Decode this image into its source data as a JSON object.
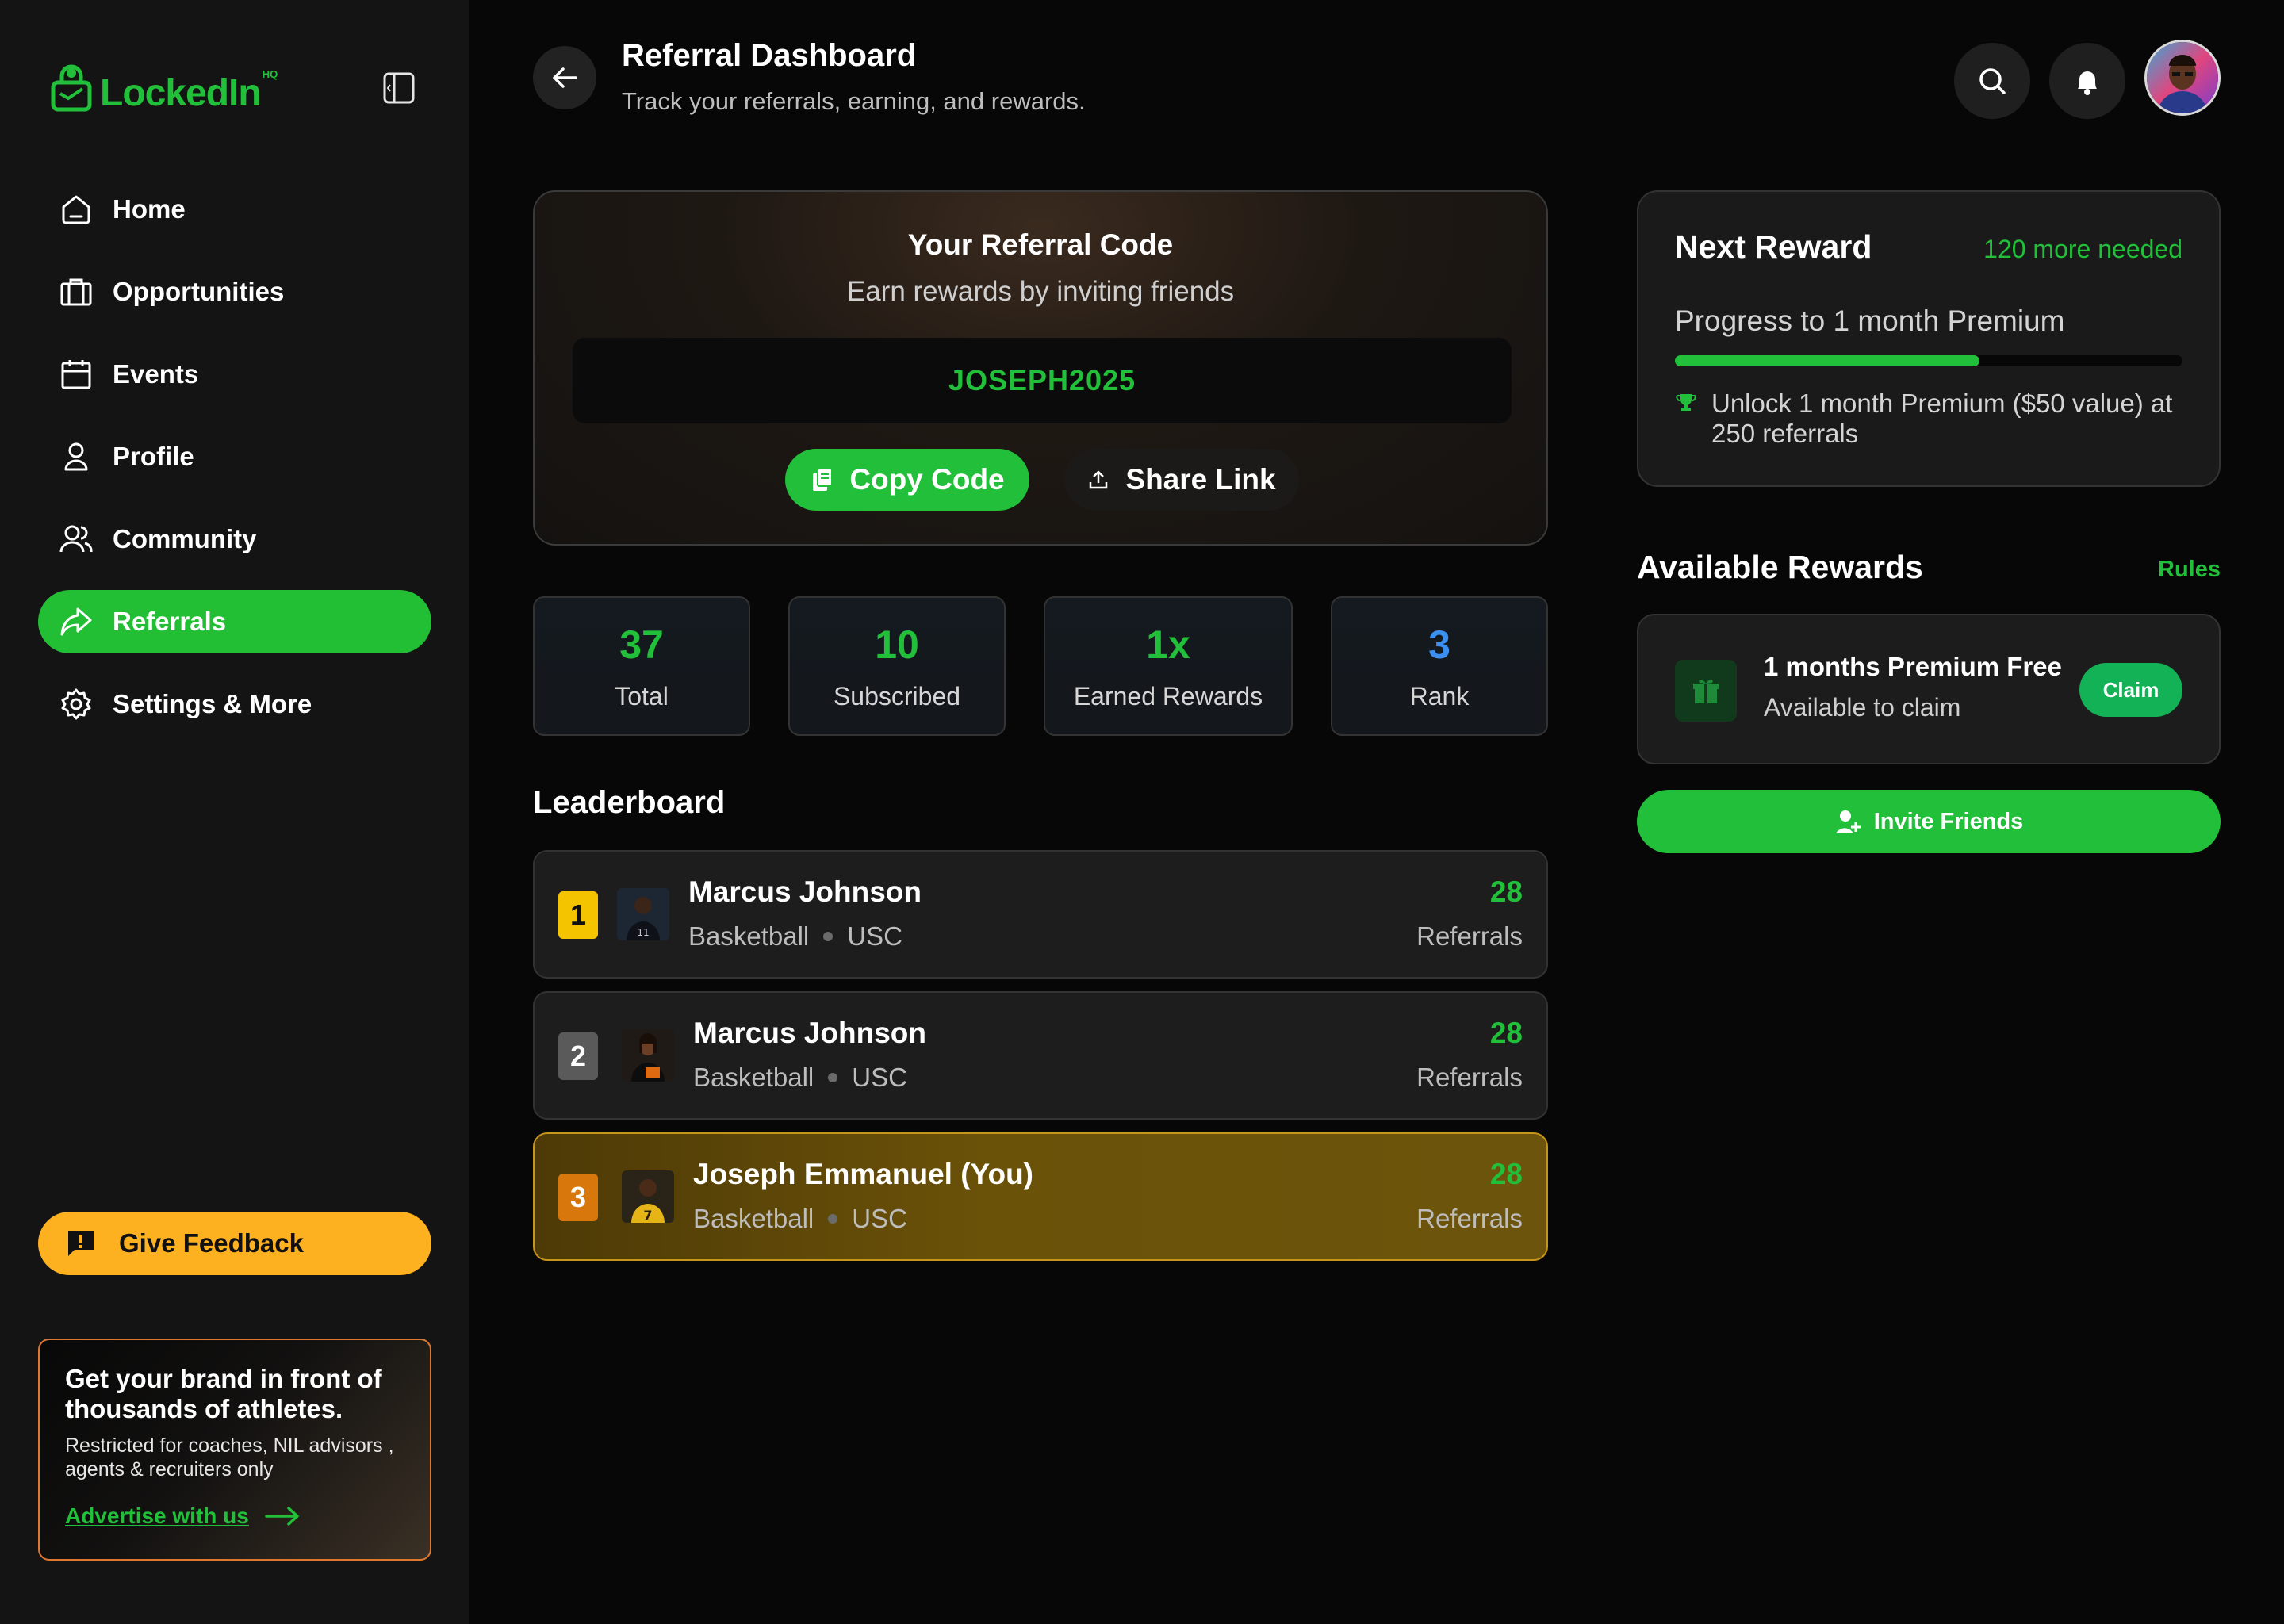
{
  "brand": {
    "name": "LockedIn",
    "suffix": "HQ"
  },
  "sidebar": {
    "items": [
      {
        "label": "Home",
        "icon": "home-icon",
        "active": false
      },
      {
        "label": "Opportunities",
        "icon": "briefcase-icon",
        "active": false
      },
      {
        "label": "Events",
        "icon": "calendar-icon",
        "active": false
      },
      {
        "label": "Profile",
        "icon": "user-icon",
        "active": false
      },
      {
        "label": "Community",
        "icon": "users-icon",
        "active": false
      },
      {
        "label": "Referrals",
        "icon": "share-arrow-icon",
        "active": true
      },
      {
        "label": "Settings & More",
        "icon": "gear-icon",
        "active": false
      }
    ],
    "feedback_label": "Give Feedback",
    "advert": {
      "title": "Get your brand in front of thousands of athletes.",
      "subtitle": "Restricted for coaches, NIL advisors , agents & recruiters only",
      "link": "Advertise with us"
    }
  },
  "header": {
    "title": "Referral Dashboard",
    "subtitle": "Track your referrals, earning, and rewards."
  },
  "referral": {
    "title": "Your Referral Code",
    "subtitle": "Earn rewards by inviting friends",
    "code": "JOSEPH2025",
    "copy_label": "Copy Code",
    "share_label": "Share Link"
  },
  "stats": [
    {
      "value": "37",
      "label": "Total",
      "color": "#22c03a"
    },
    {
      "value": "10",
      "label": "Subscribed",
      "color": "#22c03a"
    },
    {
      "value": "1x",
      "label": "Earned Rewards",
      "color": "#22c03a"
    },
    {
      "value": "3",
      "label": "Rank",
      "color": "#3b8ff0"
    }
  ],
  "leaderboard": {
    "title": "Leaderboard",
    "rows": [
      {
        "rank": "1",
        "name": "Marcus Johnson",
        "sport": "Basketball",
        "school": "USC",
        "count": "28",
        "count_label": "Referrals",
        "badge_color": "#f5c400"
      },
      {
        "rank": "2",
        "name": "Marcus Johnson",
        "sport": "Basketball",
        "school": "USC",
        "count": "28",
        "count_label": "Referrals",
        "badge_color": "#5a5a5a"
      },
      {
        "rank": "3",
        "name": "Joseph Emmanuel (You)",
        "sport": "Basketball",
        "school": "USC",
        "count": "28",
        "count_label": "Referrals",
        "badge_color": "#d8780c"
      }
    ]
  },
  "next_reward": {
    "title": "Next Reward",
    "needed": "120 more needed",
    "progress_label": "Progress to 1 month Premium",
    "progress": 0.6,
    "note": "Unlock 1 month Premium ($50 value) at 250 referrals"
  },
  "available_rewards": {
    "title": "Available Rewards",
    "rules_label": "Rules",
    "items": [
      {
        "name": "1 months Premium Free",
        "status": "Available to claim",
        "action": "Claim"
      }
    ]
  },
  "invite_label": "Invite Friends",
  "colors": {
    "accent": "#22c03a",
    "feedback": "#fdb020",
    "rank_blue": "#3b8ff0"
  }
}
